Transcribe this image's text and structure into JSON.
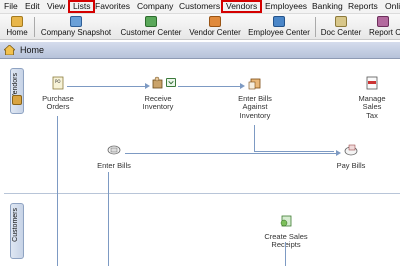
{
  "menubar": {
    "items": [
      "File",
      "Edit",
      "View",
      "Lists",
      "Favorites",
      "Company",
      "Customers",
      "Vendors",
      "Employees",
      "Banking",
      "Reports",
      "Onli"
    ]
  },
  "toolbar": {
    "items": [
      "Home",
      "Company Snapshot",
      "Customer Center",
      "Vendor Center",
      "Employee Center",
      "Doc Center",
      "Report C"
    ]
  },
  "home": {
    "title": "Home"
  },
  "vendors_tab": "Vendors",
  "customers_tab": "Customers",
  "workflow": {
    "purchase_orders": "Purchase\nOrders",
    "receive_inventory": "Receive\nInventory",
    "enter_bills_against_inventory": "Enter Bills\nAgainst\nInventory",
    "manage_sales_tax": "Manage\nSales\nTax",
    "enter_bills": "Enter Bills",
    "pay_bills": "Pay Bills",
    "create_sales_receipts": "Create Sales\nReceipts"
  },
  "colors": {
    "highlight": "#d40000",
    "flow": "#7d9ac3",
    "accent": "#1f4a8a"
  }
}
